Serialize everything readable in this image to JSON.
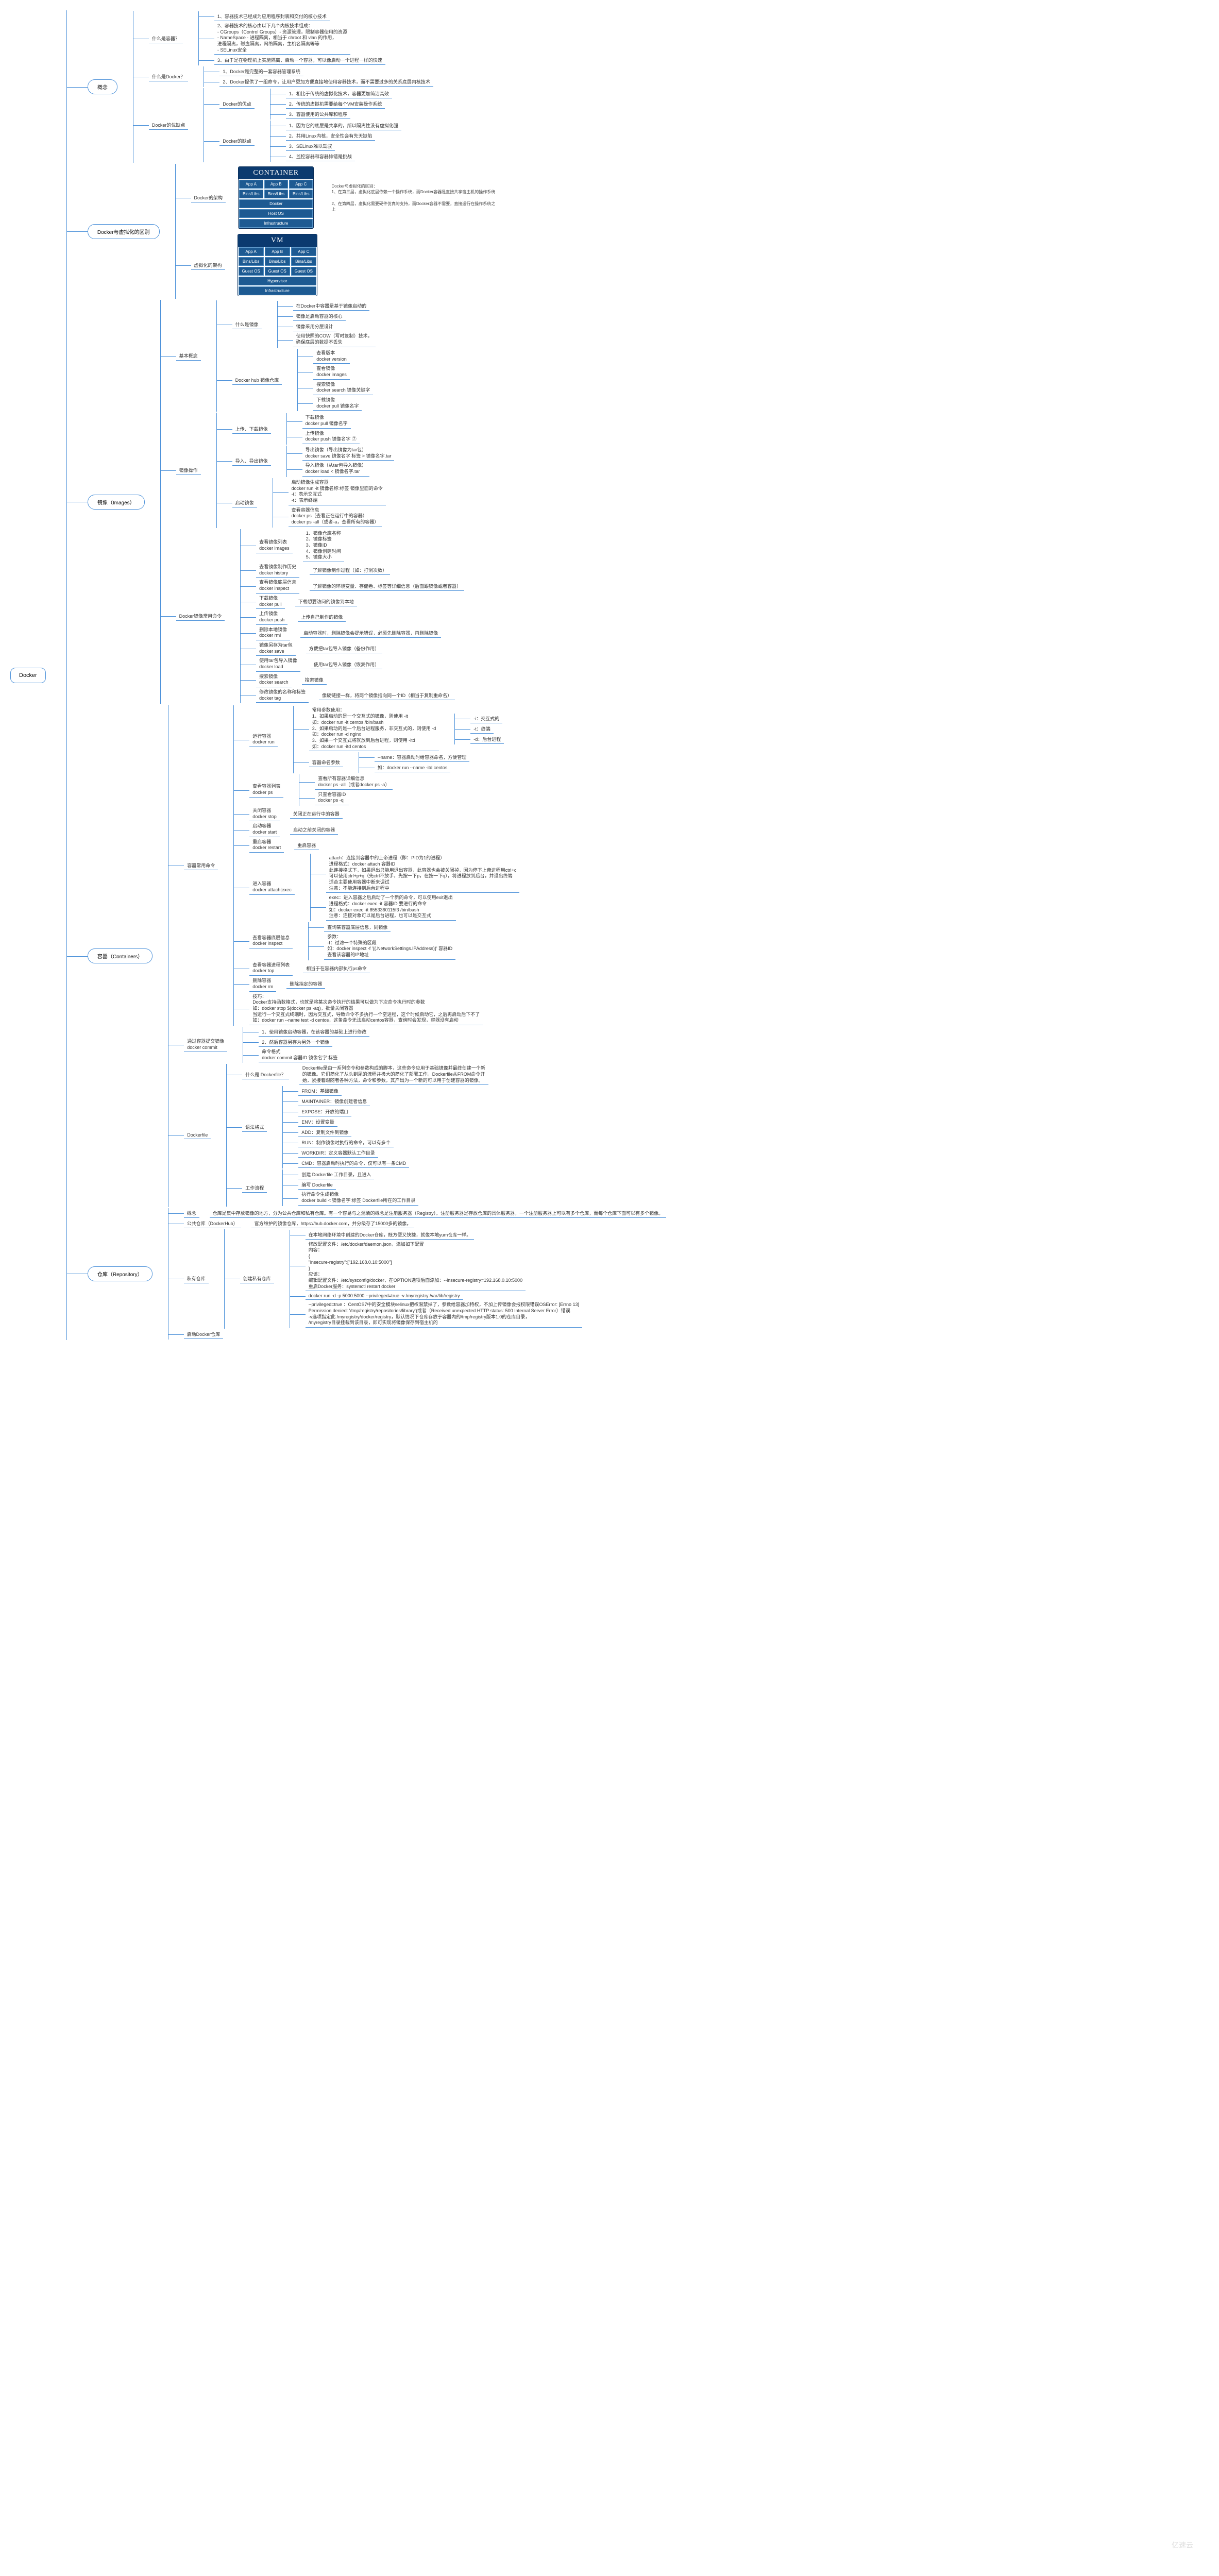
{
  "root": "Docker",
  "n1": "概念",
  "n2": "Docker与虚拟化的区别",
  "n3": "镜像（Images）",
  "n4": "容器（Containers）",
  "n5": "仓库（Repository）",
  "c1_1": "什么是容器？",
  "c1_1_1": "1、容器技术已经成为应用程序封装和交付的核心技术",
  "c1_1_2": "2、容器技术的核心由以下几个内核技术组成：\n- CGroups（Control Groups）- 资源管理，限制容器使用的资源\n- NameSpace - 进程隔离，相当于 chroot 和 vlan 的作用，\n  进程隔离，磁盘隔离，网络隔离，主机名隔离等等\n- SELinux安全",
  "c1_1_3": "3、由于是在物理机上实施隔离，启动一个容器，可以像启动一个进程一样的快速",
  "c1_2": "什么是Docker？",
  "c1_2_1": "1、Docker是完整的一套容器管理系统",
  "c1_2_2": "2、Docker提供了一组命令，让用户更加方便直接地使用容器技术，而不需要过多的关系底层内核技术",
  "c1_3": "Docker的优缺点",
  "c1_3a": "Docker的优点",
  "c1_3a_1": "1、相比于传统的虚拟化技术，容器更加简洁高效",
  "c1_3a_2": "2、传统的虚拟机需要给每个VM安装操作系统",
  "c1_3a_3": "3、容器使用的公共库和程序",
  "c1_3b": "Docker的缺点",
  "c1_3b_1": "1、因为它的底层是共享的，所以隔离性没有虚拟化强",
  "c1_3b_2": "2、共用Linux内核，安全性会有先天缺陷",
  "c1_3b_3": "3、SELinux难以驾驭",
  "c1_3b_4": "4、监控容器和容器排错是挑战",
  "c2_1": "Docker的架构",
  "c2_2": "虚拟化的架构",
  "arch_container": "CONTAINER",
  "arch_vm": "VM",
  "arch_appA": "App A",
  "arch_appB": "App B",
  "arch_appC": "App C",
  "arch_bins": "Bins/Libs",
  "arch_docker": "Docker",
  "arch_host": "Host OS",
  "arch_infra": "Infrastructure",
  "arch_guest": "Guest OS",
  "arch_hyper": "Hypervisor",
  "c2_note": "Docker与虚拟化的区别：\n1、在第三层，虚拟化底层依赖一个操作系统，而Docker容器是直接共享宿主机的操作系统\n\n2、在第四层，虚拟化需要硬件仿真的支持，而Docker容器不需要，直接运行在操作系统之\n  上",
  "c3_1": "基本概念",
  "c3_1a": "什么是镜像",
  "c3_1a_1": "在Docker中容器是基于镜像启动的",
  "c3_1a_2": "镜像是启动容器的核心",
  "c3_1a_3": "镜像采用分层设计",
  "c3_1a_4": "使用快照的COW（写时复制）技术，\n确保底层的数据不丢失",
  "c3_1b": "Docker hub 镜像仓库",
  "c3_1b_1": "查看版本\ndocker version",
  "c3_1b_2": "查看镜像\ndocker images",
  "c3_1b_3": "搜索镜像\ndocker search 镜像关键字",
  "c3_1b_4": "下载镜像\ndocker pull 镜像名字",
  "c3_2": "镜像操作",
  "c3_2a": "上传、下载镜像",
  "c3_2a_1": "下载镜像\ndocker pull 镜像名字",
  "c3_2a_2": "上传镜像\ndocker push 镜像名字  ⑦",
  "c3_2b": "导入、导出镜像",
  "c3_2b_1": "导出镜像（导出镜像为tar包）\ndocker save 镜像名字 标签 > 镜像名字.tar",
  "c3_2b_2": "导入镜像（从tar包导入镜像）\ndocker load < 镜像名字.tar",
  "c3_2c": "启动镜像",
  "c3_2c_1": "启动镜像生成容器\ndocker run -it 镜像名称:标签 镜像里面的命令\n-i：表示交互式\n-t：表示终端",
  "c3_2c_2": "查看容器信息\ndocker ps（查看正在运行中的容器）\ndocker ps -all（或者-a，查看所有的容器）",
  "c3_3": "Docker镜像常用命令",
  "c3_3a": "查看镜像列表\ndocker images",
  "c3_3a_note": "1、镜像仓库名称\n2、镜像标签\n3、镜像ID\n4、镜像创建时间\n5、镜像大小",
  "c3_3b": "查看镜像制作历史\ndocker history",
  "c3_3b_note": "了解镜像制作过程（如：打洞次数）",
  "c3_3c": "查看镜像底层信息\ndocker inspect",
  "c3_3c_note": "了解镜像的环境变量、存储卷、标签等详细信息（后面跟镜像或者容器）",
  "c3_3d": "下载镜像\ndocker pull",
  "c3_3d_note": "下载想要访问的镜像到本地",
  "c3_3e": "上传镜像\ndocker push",
  "c3_3e_note": "上传自己制作的镜像",
  "c3_3f": "删除本地镜像\ndocker rmi",
  "c3_3f_note": "启动容器时，删除镜像会提示错误，必须先删除容器，再删除镜像",
  "c3_3g": "镜像另存为tar包\ndocker save",
  "c3_3g_note": "方便把tar包导入镜像（备份作用）",
  "c3_3h": "使用tar包导入镜像\ndocker load",
  "c3_3h_note": "使用tar包导入镜像（恢复作用）",
  "c3_3i": "搜索镜像\ndocker search",
  "c3_3i_note": "搜索镜像",
  "c3_3j": "修改镜像的名称和标签\ndocker tag",
  "c3_3j_note": "像硬链接一样，将两个镜像指向同一个ID（相当于复制重命名）",
  "c4_1": "容器常用命令",
  "c4_1a": "运行容器\ndocker run",
  "c4_1a_1": "常用参数使用：\n1、如果启动的是一个交互式的镜像，则使用 -it\n如：docker run -it centos /bin/bash\n2、如果启动的是一个后台进程服务，非交互式的，则使用 -d\n如：docker run -d nginx\n3、如果一个交互式将就放到后台进程，则使用 -itd\n如：docker run -itd centos",
  "c4_1a_1_i": "-i：交互式的",
  "c4_1a_1_t": "-t：终端",
  "c4_1a_1_d": "-d：后台进程",
  "c4_1a_2": "容器命名参数",
  "c4_1a_2_1": "--name：容器启动时给容器命名，方便管理",
  "c4_1a_2_2": "如：docker run --name -itd centos",
  "c4_1b": "查看容器列表\ndocker ps",
  "c4_1b_1": "查看所有容器详细信息\ndocker ps -all（或者docker ps -a）",
  "c4_1b_2": "只查看容器ID\ndocker ps -q",
  "c4_1c": "关闭容器\ndocker stop",
  "c4_1c_note": "关闭正在运行中的容器",
  "c4_1d": "启动容器\ndocker start",
  "c4_1d_note": "启动之前关闭的容器",
  "c4_1e": "重启容器\ndocker restart",
  "c4_1e_note": "重启容器",
  "c4_1f": "进入容器\ndocker attach|exec",
  "c4_1f_1": "attach：连接到容器中的上帝进程（即：PID为1的进程）\n进程格式：docker attach 容器ID\n此连接格式下，如果退出只能用退出容器，此容器也会被关闭掉，因为停下上帝进程用ctrl+c\n可以使用ctrl+p+q（先ctrl不放手，先按一下p，在按一下q），将进程放到后台，并退出终端\n适合主要使用容器中断来调试\n注意：不能连接到后台进程中",
  "c4_1f_2": "exec：进入容器之后启动了一个新的命令，可以使用exit退出\n进程格式：docker exec -it 容器ID 要进行的命令\n如：docker exec -it 8553360115f3 /bin/bash\n注意：连接对象可以是后台进程，也可以是交互式",
  "c4_1g": "查看容器底层信息\ndocker inspect",
  "c4_1g_1": "查询某容器底层信息，同镜像",
  "c4_1g_2": "参数：\n-f：过滤一个特殊的区段\n如：docker inspect -f '{{.NetworkSettings.IPAddress}}' 容器ID\n查看该容器的IP地址",
  "c4_1h": "查看容器进程列表\ndocker top",
  "c4_1h_note": "相当于在容器内部执行ps命令",
  "c4_1i": "删除容器\ndocker rm",
  "c4_1i_note": "删除指定的容器",
  "c4_1j": "技巧：\nDocker支持函数格式，也就是将某次命令执行的结果可以做为下次命令执行时的参数\n如：docker stop $(docker ps -aq)，批量关闭容器\n当运行一个交互式终端时，因为交互式，导致命令不多执行一个空进程，这个时候启动它，之后再启动后下不了\n如：docker run --name test -d centos，这条命令无法启动centos容器，查询时会发现，容器没有启动",
  "c4_2": "通过容器提交镜像\ndocker commit",
  "c4_2_1": "1、使用镜像启动容器，在该容器的基础上进行修改",
  "c4_2_2": "2、然后容器另存为另外一个镜像",
  "c4_2_3": "命令格式\ndocker commit 容器ID 镜像名字:标签",
  "c4_3": "Dockerfile",
  "c4_3a": "什么是 Dockerfile？",
  "c4_3a_note": "Dockerfile是由一系列命令和参数构成的脚本，这些命令应用于基础镜像并最终创建一个新\n的镜像。它们简化了从头到尾的流程并极大的简化了部署工作。Dockerfile从FROM命令开\n始，紧接着跟随者各种方法，命令和参数。其产出为一个新的可以用于创建容器的镜像。",
  "c4_3b": "语法格式",
  "c4_3b_1": "FROM：基础镜像",
  "c4_3b_2": "MAINTAINER：镜像创建者信息",
  "c4_3b_3": "EXPOSE：开放的端口",
  "c4_3b_4": "ENV：设置变量",
  "c4_3b_5": "ADD：复制文件到镜像",
  "c4_3b_6": "RUN：制作镜像时执行的命令，可以有多个",
  "c4_3b_7": "WORKDIR：定义容器默认工作目录",
  "c4_3b_8": "CMD：容器启动时执行的命令，仅可以有一条CMD",
  "c4_3c": "工作流程",
  "c4_3c_1": "创建 Dockerfile 工作目录，且进入",
  "c4_3c_2": "编写 Dockerfile",
  "c4_3c_3": "执行命令生成镜像\ndocker build -t 镜像名字:标签 Dockerfile所在的工作目录",
  "c5_0": "概念",
  "c5_0_note": "仓库是集中存放镜像的地方，分为公共仓库和私有仓库。有一个容易与之混淆的概念是注册服务器（Registry）。注册服务器是存放仓库的具体服务器，一个注册服务器上可以有多个仓库，而每个仓库下面可以有多个镜像。",
  "c5_1": "公共仓库（DockerHub）",
  "c5_1_note": "官方维护的镜像仓库，https://hub.docker.com，并分级存了15000多的镜像。",
  "c5_2": "私有仓库",
  "c5_2a": "创建私有仓库",
  "c5_2a_0": "在本地网络环境中创建的Docker仓库，既方便又快捷，就像本地yum仓库一样。",
  "c5_2a_1": "修改配置文件：/etc/docker/daemon.json，添加如下配置\n内容：\n{\n  \"insecure-registry\":[\"192.168.0.10:5000\"]\n}\n应该：\n编辑配置文件：/etc/sysconfig/docker，在OPTION选项后面添加：--insecure-registry=192.168.0.10:5000\n重启Docker服务：systemctl restart docker",
  "c5_2a_2": "docker run -d -p 5000:5000 --privileged=true -v /myregistry:/var/lib/registry",
  "c5_2a_3": "--privileged=true ：CentOS7中的安全模块selinux把权限禁掉了，参数给容器加特权，不加上传镜像会报权限错误OSError: [Errno 13]\nPermission denied: '/tmp/registry/repositories/library')或者（Received unexpected HTTP status: 500 Internal Server Error）错误\n-v选项指定此 /myregistry/docker/registry，默认情况下仓库存放于容器内的/tmp/registry版本1.0的仓库目录，\n/myregistry目录挂载到该目录，即可实现将镜像保存到宿主机的",
  "c5_3": "启动Docker仓库"
}
